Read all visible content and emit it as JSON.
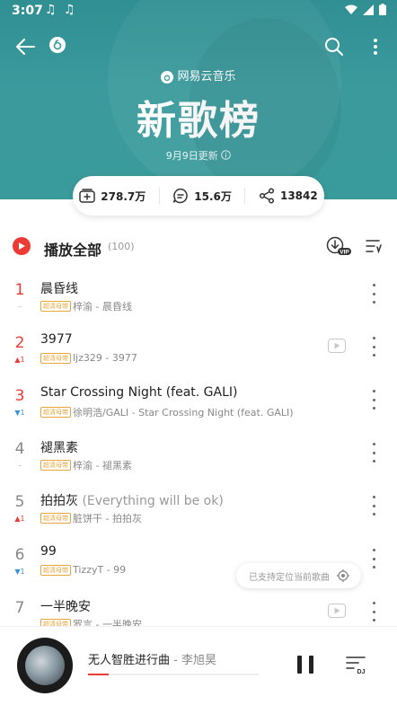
{
  "status": {
    "time": "3:07",
    "notes": "♫ ♫"
  },
  "header": {
    "brand": "网易云音乐",
    "title": "新歌榜",
    "updated": "9月9日更新"
  },
  "stats": {
    "collect": "278.7万",
    "comments": "15.6万",
    "shares": "13842"
  },
  "playall": {
    "label": "播放全部",
    "count": "(100)",
    "vip_badge": "VIP"
  },
  "badge_text": "超清母带",
  "songs": [
    {
      "rank": "1",
      "trend": "–",
      "title": "晨昏线",
      "alt": "",
      "sub": "梓渝 - 晨昏线",
      "mv": false
    },
    {
      "rank": "2",
      "trend": "▲1",
      "title": "3977",
      "alt": "",
      "sub": "ljz329 - 3977",
      "mv": true
    },
    {
      "rank": "3",
      "trend": "▼1",
      "title": "Star Crossing Night (feat. GALI)",
      "alt": "",
      "sub": "徐明浩/GALI - Star Crossing Night (feat. GALI)",
      "mv": false
    },
    {
      "rank": "4",
      "trend": "–",
      "title": "褪黑素",
      "alt": "",
      "sub": "梓渝 - 褪黑素",
      "mv": false
    },
    {
      "rank": "5",
      "trend": "▲1",
      "title": "拍拍灰",
      "alt": " (Everything will be ok)",
      "sub": "脏饼干 - 拍拍灰",
      "mv": false
    },
    {
      "rank": "6",
      "trend": "▼1",
      "title": "99",
      "alt": "",
      "sub": "TizzyT - 99",
      "mv": false
    },
    {
      "rank": "7",
      "trend": "",
      "title": "一半晚安",
      "alt": "",
      "sub": "罗言 - 一半晚安",
      "mv": true
    }
  ],
  "locate_tip": "已支持定位当前歌曲",
  "player": {
    "song": "无人智胜进行曲",
    "artist": " - 李旭昊",
    "dj_label": "DJ",
    "progress": 0.12
  },
  "colors": {
    "accent": "#ec3b35",
    "header": "#3a9a9c",
    "badge": "#e8a53a",
    "trend_down": "#3a92d9"
  }
}
